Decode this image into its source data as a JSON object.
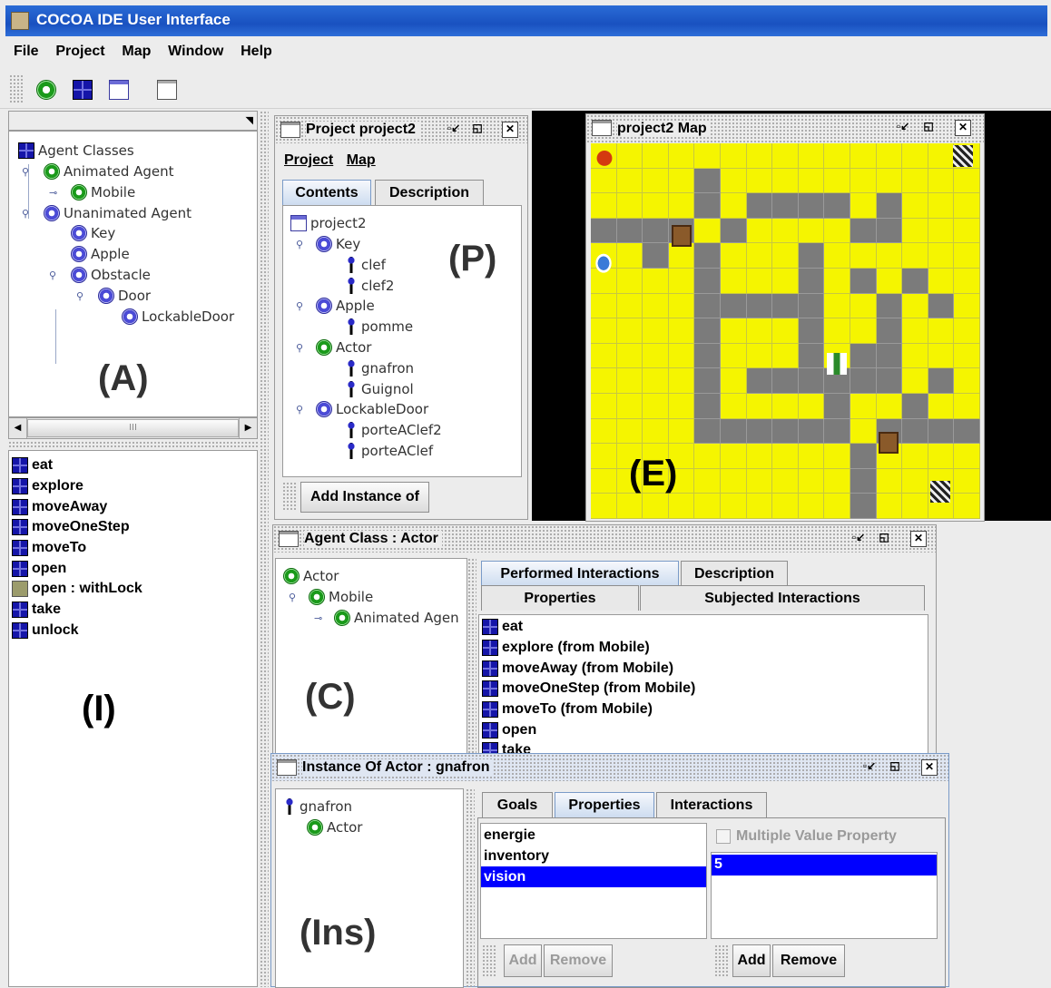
{
  "window": {
    "title": "COCOA IDE User Interface"
  },
  "menubar": {
    "items": [
      "File",
      "Project",
      "Map",
      "Window",
      "Help"
    ]
  },
  "toolbar": {
    "buttons": [
      "new-animated-agent-icon",
      "new-class-icon",
      "edit-project-icon",
      "open-map-icon"
    ]
  },
  "agent_classes": {
    "root": "Agent Classes",
    "animated": "Animated Agent",
    "mobile": "Mobile",
    "unanimated": "Unanimated Agent",
    "key": "Key",
    "apple": "Apple",
    "obstacle": "Obstacle",
    "door": "Door",
    "lockable_door": "LockableDoor",
    "region_label": "(A)",
    "scroll_mid": "III"
  },
  "interactions": {
    "items": [
      "eat",
      "explore",
      "moveAway",
      "moveOneStep",
      "moveTo",
      "open",
      "open : withLock",
      "take",
      "unlock"
    ],
    "region_label": "(I)"
  },
  "project_frame": {
    "title": "Project project2",
    "menu_project": "Project",
    "menu_map": "Map",
    "tab_contents": "Contents",
    "tab_description": "Description",
    "tree": {
      "root": "project2",
      "key": "Key",
      "clef": "clef",
      "clef2": "clef2",
      "apple": "Apple",
      "pomme": "pomme",
      "actor": "Actor",
      "gnafron": "gnafron",
      "guignol": "Guignol",
      "lockable": "LockableDoor",
      "porte2": "porteAClef2",
      "porte1": "porteAClef"
    },
    "add_instance": "Add Instance of",
    "region_label": "(P)"
  },
  "map_frame": {
    "title": "project2 Map",
    "region_label": "(E)"
  },
  "class_frame": {
    "title": "Agent Class : Actor",
    "tree": {
      "actor": "Actor",
      "mobile": "Mobile",
      "animated": "Animated Agen"
    },
    "tab_performed": "Performed Interactions",
    "tab_description": "Description",
    "tab_properties": "Properties",
    "tab_subjected": "Subjected Interactions",
    "list": [
      "eat",
      "explore (from Mobile)",
      "moveAway (from Mobile)",
      "moveOneStep (from Mobile)",
      "moveTo (from Mobile)",
      "open",
      "take"
    ],
    "region_label": "(C)"
  },
  "instance_frame": {
    "title": "Instance Of Actor : gnafron",
    "tree": {
      "gnafron": "gnafron",
      "actor": "Actor"
    },
    "tab_goals": "Goals",
    "tab_properties": "Properties",
    "tab_interactions": "Interactions",
    "properties": [
      "energie",
      "inventory",
      "vision"
    ],
    "selected_property": "vision",
    "multiple_value_label": "Multiple Value Property",
    "value": "5",
    "add_left": "Add",
    "remove_left": "Remove",
    "add_right": "Add",
    "remove_right": "Remove",
    "region_label": "(Ins)"
  },
  "colors": {
    "titlebar": "#1951c0",
    "selection": "#0000ff",
    "map_floor": "#f5f500",
    "map_wall": "#7b7b7b"
  }
}
